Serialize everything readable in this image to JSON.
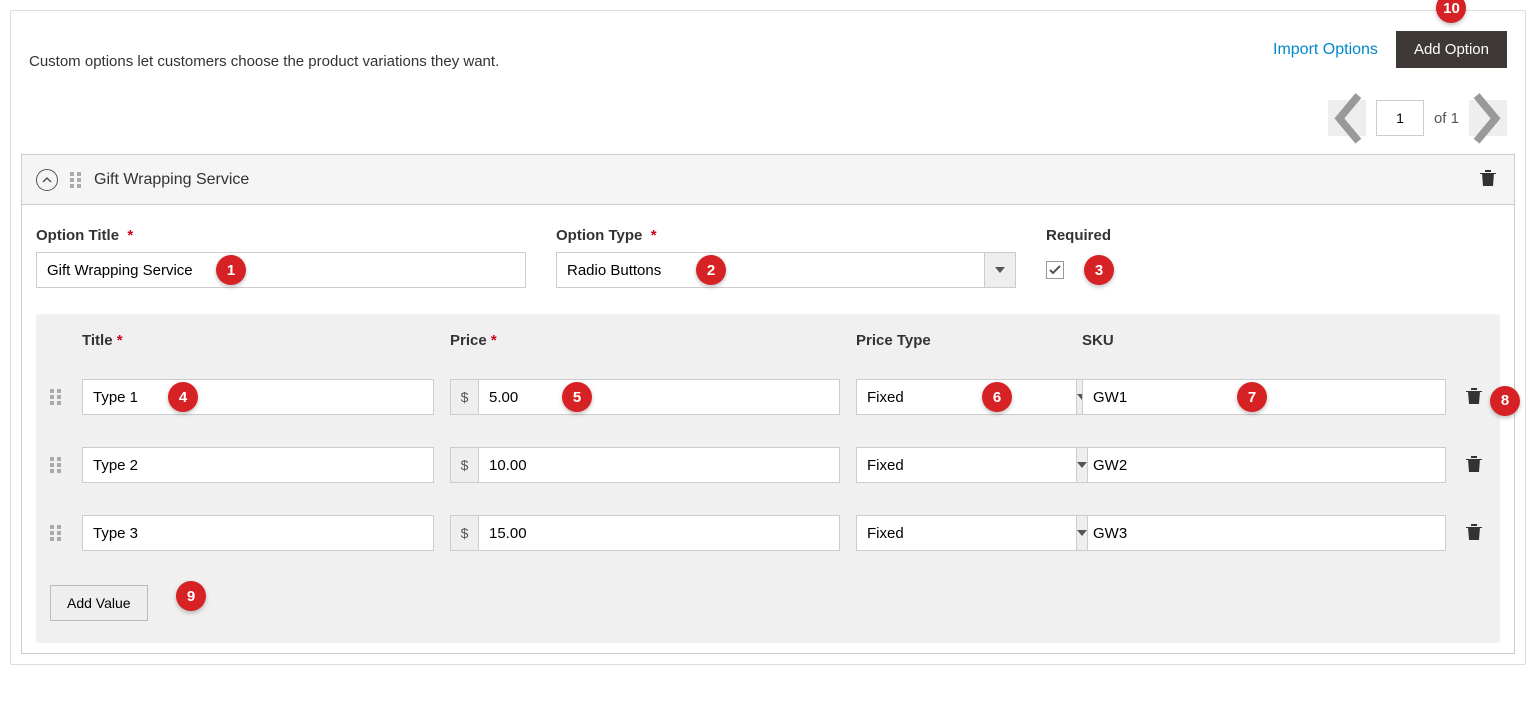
{
  "intro_text": "Custom options let customers choose the product variations they want.",
  "actions": {
    "import_label": "Import Options",
    "add_option_label": "Add Option"
  },
  "pagination": {
    "current": "1",
    "total_text": "of 1"
  },
  "option": {
    "header_name": "Gift Wrapping Service",
    "labels": {
      "title": "Option Title",
      "type": "Option Type",
      "required": "Required"
    },
    "title_value": "Gift Wrapping Service",
    "type_value": "Radio Buttons",
    "required_checked": true
  },
  "values": {
    "headers": {
      "title": "Title",
      "price": "Price",
      "price_type": "Price Type",
      "sku": "SKU"
    },
    "currency": "$",
    "rows": [
      {
        "title": "Type 1",
        "price": "5.00",
        "price_type": "Fixed",
        "sku": "GW1"
      },
      {
        "title": "Type 2",
        "price": "10.00",
        "price_type": "Fixed",
        "sku": "GW2"
      },
      {
        "title": "Type 3",
        "price": "15.00",
        "price_type": "Fixed",
        "sku": "GW3"
      }
    ],
    "add_value_label": "Add Value"
  },
  "callouts": {
    "c1": "1",
    "c2": "2",
    "c3": "3",
    "c4": "4",
    "c5": "5",
    "c6": "6",
    "c7": "7",
    "c8": "8",
    "c9": "9",
    "c10": "10"
  }
}
